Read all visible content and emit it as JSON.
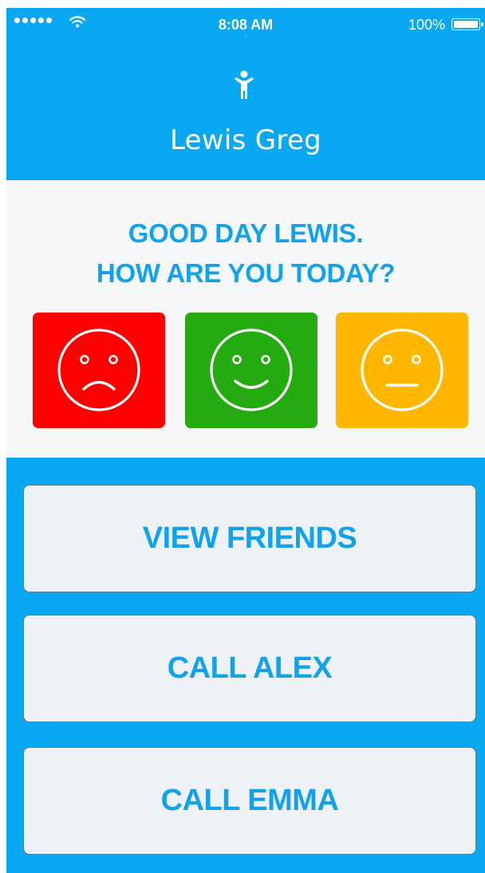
{
  "status_bar": {
    "time": "8:08 AM",
    "battery_percent": "100%",
    "signal_bars": 5,
    "icons": [
      "signal-dots-icon",
      "wifi-icon",
      "battery-icon"
    ]
  },
  "header": {
    "icon": "person-icon",
    "user_name": "Lewis Greg"
  },
  "mood_panel": {
    "greeting_line1": "GOOD DAY LEWIS.",
    "greeting_line2": "HOW ARE YOU TODAY?",
    "moods": [
      {
        "icon": "sad-face-icon",
        "color": "#ff0000"
      },
      {
        "icon": "happy-face-icon",
        "color": "#24ab10"
      },
      {
        "icon": "neutral-face-icon",
        "color": "#ffb700"
      }
    ]
  },
  "actions": {
    "view_friends": "VIEW FRIENDS",
    "call_alex": "CALL ALEX",
    "call_emma": "CALL EMMA"
  },
  "colors": {
    "brand_blue": "#08a9f2",
    "text_blue": "#11a2eb",
    "panel_bg": "#f6f7f9",
    "button_bg": "#eef2f6"
  }
}
